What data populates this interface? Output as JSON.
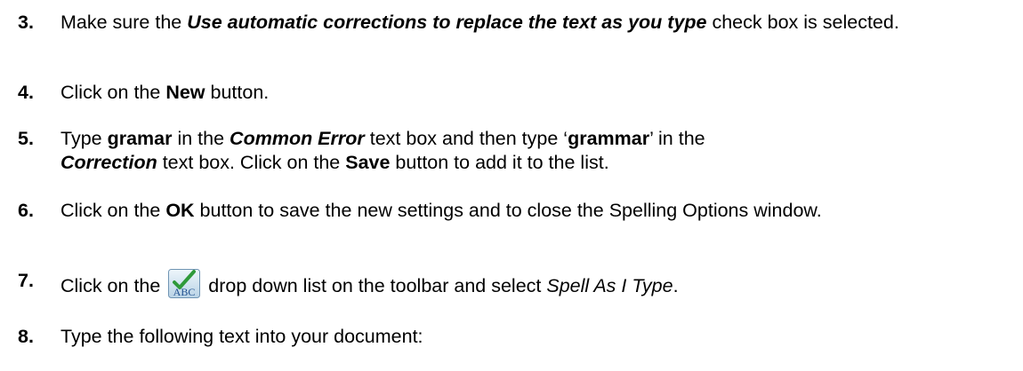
{
  "steps": [
    {
      "number": "3.",
      "parts": [
        "Make sure the ",
        "Use automatic corrections to replace the text as you type",
        " check box is selected."
      ]
    },
    {
      "number": "4.",
      "parts": [
        "Click on the ",
        "New",
        " button."
      ]
    },
    {
      "number": "5.",
      "parts": [
        "Type ",
        "gramar",
        " in the ",
        "Common Error",
        " text box and then type ‘",
        "grammar",
        "’ in the",
        "Correction",
        " text box. Click on the ",
        "Save",
        " button to add it to the list."
      ]
    },
    {
      "number": "6.",
      "parts": [
        "Click on the ",
        "OK",
        " button to save the new settings and to close the Spelling Options window."
      ]
    },
    {
      "number": "7.",
      "parts": [
        "Click on the ",
        " drop down list on the toolbar and select ",
        "Spell As I Type",
        "."
      ],
      "icon": {
        "name": "spell-check-abc-icon",
        "label": "ABC"
      }
    },
    {
      "number": "8.",
      "parts": [
        "Type the following text into your document:"
      ]
    }
  ]
}
